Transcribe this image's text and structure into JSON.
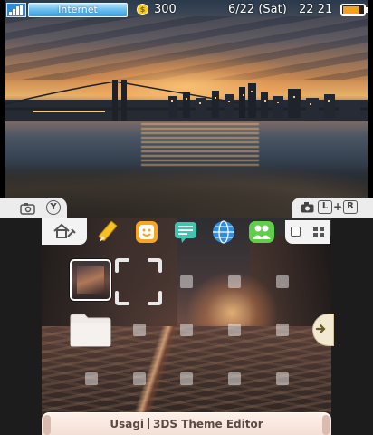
{
  "status_bar": {
    "connection_label": "Internet",
    "coin_count": "300",
    "date": "6/22 (Sat)",
    "time": "22 21",
    "battery_level": 0.8,
    "signal_icon": "signal-bars-icon",
    "coin_icon": "play-coin-icon"
  },
  "hints": {
    "left_icon": "camera-icon",
    "left_button": "Y",
    "right_icon": "camera-icon",
    "right_button_l": "L",
    "right_plus": "+",
    "right_button_r": "R"
  },
  "menu_bar": {
    "settings_icon": "home-settings-icon",
    "apps": [
      {
        "name": "notes-app",
        "icon": "pencil-icon",
        "color": "#f7c21f"
      },
      {
        "name": "miiverse-app",
        "icon": "smiley-face-icon",
        "color": "#f6a623"
      },
      {
        "name": "notifications-app",
        "icon": "speech-bubble-icon",
        "color": "#3fc6b1"
      },
      {
        "name": "browser-app",
        "icon": "globe-icon",
        "color": "#2d8ee6"
      },
      {
        "name": "friends-app",
        "icon": "friends-icon",
        "color": "#5fcf4a"
      }
    ],
    "view_single_icon": "single-view-icon",
    "view_grid_icon": "grid-view-icon"
  },
  "home_grid": {
    "selected_icon": "selection-cursor-icon",
    "camera_slot": "camera-thumbnail",
    "folder_icon": "folder-icon",
    "scroll_icon": "arrow-right-icon"
  },
  "bottom_bar": {
    "author": "Usagi",
    "app_title": "3DS Theme Editor"
  },
  "colors": {
    "internet_badge": "#3d9fe0",
    "battery": "#f4a21e",
    "bottom_bar_text": "#5a4a46",
    "tab_bg": "#ececec"
  }
}
